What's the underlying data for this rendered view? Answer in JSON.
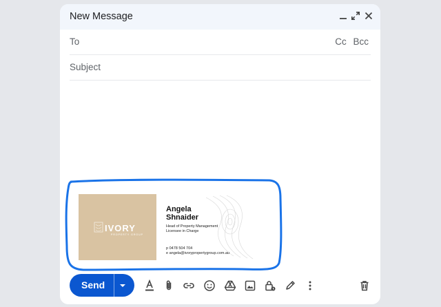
{
  "compose": {
    "title": "New Message",
    "to_label": "To",
    "cc_label": "Cc",
    "bcc_label": "Bcc",
    "subject_placeholder": "Subject"
  },
  "signature": {
    "logo_text": "IVORY",
    "logo_subtext": "PROPERTY GROUP",
    "name_line1": "Angela",
    "name_line2": "Shnaider",
    "role_line1": "Head of Property Management",
    "role_line2": "Licensee in Charge",
    "phone": "p 0478 504 704",
    "email": "e angela@ivorypropertygroup.com.au"
  },
  "toolbar": {
    "send_label": "Send"
  },
  "colors": {
    "accent": "#0b57d0",
    "outline": "#1a73e8",
    "logo_bg": "#d9c3a2",
    "titlebar_bg": "#f2f6fc"
  },
  "icons": [
    "minimize-icon",
    "expand-icon",
    "close-icon",
    "text-format-icon",
    "attach-icon",
    "link-icon",
    "emoji-icon",
    "drive-icon",
    "image-icon",
    "confidential-lock-icon",
    "signature-pen-icon",
    "more-options-icon",
    "trash-icon"
  ]
}
